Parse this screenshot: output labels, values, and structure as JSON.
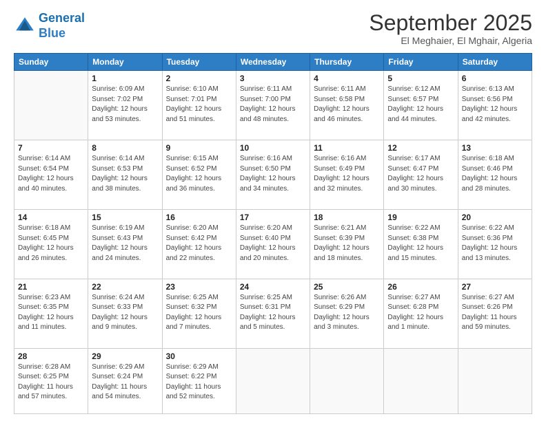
{
  "logo": {
    "line1": "General",
    "line2": "Blue"
  },
  "header": {
    "month": "September 2025",
    "location": "El Meghaier, El Mghair, Algeria"
  },
  "days_of_week": [
    "Sunday",
    "Monday",
    "Tuesday",
    "Wednesday",
    "Thursday",
    "Friday",
    "Saturday"
  ],
  "weeks": [
    [
      {
        "day": "",
        "sunrise": "",
        "sunset": "",
        "daylight": ""
      },
      {
        "day": "1",
        "sunrise": "Sunrise: 6:09 AM",
        "sunset": "Sunset: 7:02 PM",
        "daylight": "Daylight: 12 hours and 53 minutes."
      },
      {
        "day": "2",
        "sunrise": "Sunrise: 6:10 AM",
        "sunset": "Sunset: 7:01 PM",
        "daylight": "Daylight: 12 hours and 51 minutes."
      },
      {
        "day": "3",
        "sunrise": "Sunrise: 6:11 AM",
        "sunset": "Sunset: 7:00 PM",
        "daylight": "Daylight: 12 hours and 48 minutes."
      },
      {
        "day": "4",
        "sunrise": "Sunrise: 6:11 AM",
        "sunset": "Sunset: 6:58 PM",
        "daylight": "Daylight: 12 hours and 46 minutes."
      },
      {
        "day": "5",
        "sunrise": "Sunrise: 6:12 AM",
        "sunset": "Sunset: 6:57 PM",
        "daylight": "Daylight: 12 hours and 44 minutes."
      },
      {
        "day": "6",
        "sunrise": "Sunrise: 6:13 AM",
        "sunset": "Sunset: 6:56 PM",
        "daylight": "Daylight: 12 hours and 42 minutes."
      }
    ],
    [
      {
        "day": "7",
        "sunrise": "Sunrise: 6:14 AM",
        "sunset": "Sunset: 6:54 PM",
        "daylight": "Daylight: 12 hours and 40 minutes."
      },
      {
        "day": "8",
        "sunrise": "Sunrise: 6:14 AM",
        "sunset": "Sunset: 6:53 PM",
        "daylight": "Daylight: 12 hours and 38 minutes."
      },
      {
        "day": "9",
        "sunrise": "Sunrise: 6:15 AM",
        "sunset": "Sunset: 6:52 PM",
        "daylight": "Daylight: 12 hours and 36 minutes."
      },
      {
        "day": "10",
        "sunrise": "Sunrise: 6:16 AM",
        "sunset": "Sunset: 6:50 PM",
        "daylight": "Daylight: 12 hours and 34 minutes."
      },
      {
        "day": "11",
        "sunrise": "Sunrise: 6:16 AM",
        "sunset": "Sunset: 6:49 PM",
        "daylight": "Daylight: 12 hours and 32 minutes."
      },
      {
        "day": "12",
        "sunrise": "Sunrise: 6:17 AM",
        "sunset": "Sunset: 6:47 PM",
        "daylight": "Daylight: 12 hours and 30 minutes."
      },
      {
        "day": "13",
        "sunrise": "Sunrise: 6:18 AM",
        "sunset": "Sunset: 6:46 PM",
        "daylight": "Daylight: 12 hours and 28 minutes."
      }
    ],
    [
      {
        "day": "14",
        "sunrise": "Sunrise: 6:18 AM",
        "sunset": "Sunset: 6:45 PM",
        "daylight": "Daylight: 12 hours and 26 minutes."
      },
      {
        "day": "15",
        "sunrise": "Sunrise: 6:19 AM",
        "sunset": "Sunset: 6:43 PM",
        "daylight": "Daylight: 12 hours and 24 minutes."
      },
      {
        "day": "16",
        "sunrise": "Sunrise: 6:20 AM",
        "sunset": "Sunset: 6:42 PM",
        "daylight": "Daylight: 12 hours and 22 minutes."
      },
      {
        "day": "17",
        "sunrise": "Sunrise: 6:20 AM",
        "sunset": "Sunset: 6:40 PM",
        "daylight": "Daylight: 12 hours and 20 minutes."
      },
      {
        "day": "18",
        "sunrise": "Sunrise: 6:21 AM",
        "sunset": "Sunset: 6:39 PM",
        "daylight": "Daylight: 12 hours and 18 minutes."
      },
      {
        "day": "19",
        "sunrise": "Sunrise: 6:22 AM",
        "sunset": "Sunset: 6:38 PM",
        "daylight": "Daylight: 12 hours and 15 minutes."
      },
      {
        "day": "20",
        "sunrise": "Sunrise: 6:22 AM",
        "sunset": "Sunset: 6:36 PM",
        "daylight": "Daylight: 12 hours and 13 minutes."
      }
    ],
    [
      {
        "day": "21",
        "sunrise": "Sunrise: 6:23 AM",
        "sunset": "Sunset: 6:35 PM",
        "daylight": "Daylight: 12 hours and 11 minutes."
      },
      {
        "day": "22",
        "sunrise": "Sunrise: 6:24 AM",
        "sunset": "Sunset: 6:33 PM",
        "daylight": "Daylight: 12 hours and 9 minutes."
      },
      {
        "day": "23",
        "sunrise": "Sunrise: 6:25 AM",
        "sunset": "Sunset: 6:32 PM",
        "daylight": "Daylight: 12 hours and 7 minutes."
      },
      {
        "day": "24",
        "sunrise": "Sunrise: 6:25 AM",
        "sunset": "Sunset: 6:31 PM",
        "daylight": "Daylight: 12 hours and 5 minutes."
      },
      {
        "day": "25",
        "sunrise": "Sunrise: 6:26 AM",
        "sunset": "Sunset: 6:29 PM",
        "daylight": "Daylight: 12 hours and 3 minutes."
      },
      {
        "day": "26",
        "sunrise": "Sunrise: 6:27 AM",
        "sunset": "Sunset: 6:28 PM",
        "daylight": "Daylight: 12 hours and 1 minute."
      },
      {
        "day": "27",
        "sunrise": "Sunrise: 6:27 AM",
        "sunset": "Sunset: 6:26 PM",
        "daylight": "Daylight: 11 hours and 59 minutes."
      }
    ],
    [
      {
        "day": "28",
        "sunrise": "Sunrise: 6:28 AM",
        "sunset": "Sunset: 6:25 PM",
        "daylight": "Daylight: 11 hours and 57 minutes."
      },
      {
        "day": "29",
        "sunrise": "Sunrise: 6:29 AM",
        "sunset": "Sunset: 6:24 PM",
        "daylight": "Daylight: 11 hours and 54 minutes."
      },
      {
        "day": "30",
        "sunrise": "Sunrise: 6:29 AM",
        "sunset": "Sunset: 6:22 PM",
        "daylight": "Daylight: 11 hours and 52 minutes."
      },
      {
        "day": "",
        "sunrise": "",
        "sunset": "",
        "daylight": ""
      },
      {
        "day": "",
        "sunrise": "",
        "sunset": "",
        "daylight": ""
      },
      {
        "day": "",
        "sunrise": "",
        "sunset": "",
        "daylight": ""
      },
      {
        "day": "",
        "sunrise": "",
        "sunset": "",
        "daylight": ""
      }
    ]
  ]
}
